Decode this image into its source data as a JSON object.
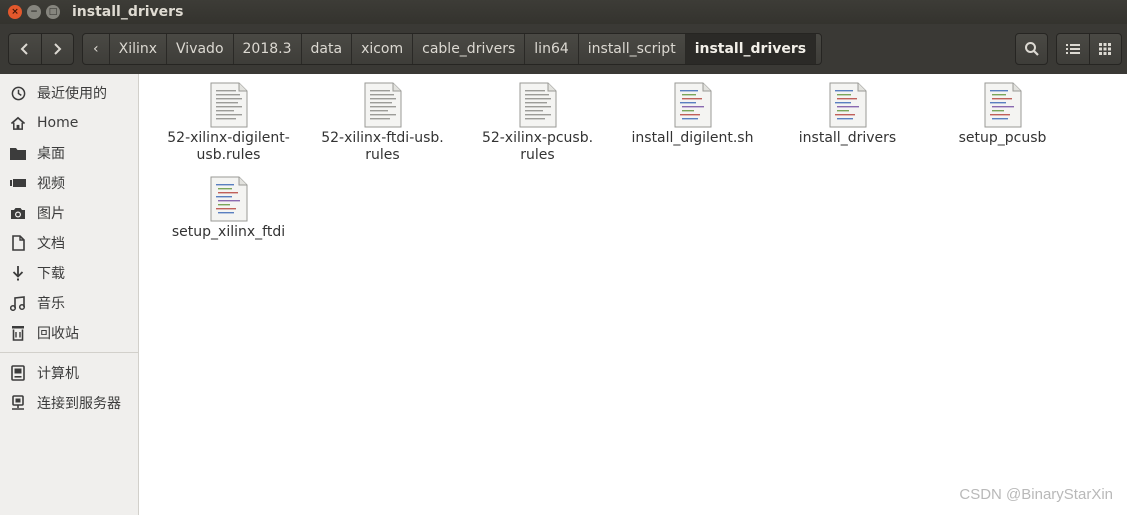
{
  "window": {
    "title": "install_drivers",
    "close_glyph": "×",
    "minimize_glyph": "−",
    "maximize_glyph": "□"
  },
  "toolbar": {
    "back_icon": "chevron-left-icon",
    "forward_icon": "chevron-right-icon",
    "path_left_arrow": "‹",
    "path_right_arrow": "›",
    "breadcrumbs": [
      "Xilinx",
      "Vivado",
      "2018.3",
      "data",
      "xicom",
      "cable_drivers",
      "lin64",
      "install_script",
      "install_drivers"
    ]
  },
  "sidebar": {
    "items": [
      {
        "label": "最近使用的",
        "icon": "clock-icon"
      },
      {
        "label": "Home",
        "icon": "home-icon"
      },
      {
        "label": "桌面",
        "icon": "folder-icon"
      },
      {
        "label": "视频",
        "icon": "video-icon"
      },
      {
        "label": "图片",
        "icon": "camera-icon"
      },
      {
        "label": "文档",
        "icon": "document-icon"
      },
      {
        "label": "下载",
        "icon": "download-icon"
      },
      {
        "label": "音乐",
        "icon": "music-icon"
      },
      {
        "label": "回收站",
        "icon": "trash-icon"
      },
      {
        "label": "计算机",
        "icon": "computer-icon"
      },
      {
        "label": "连接到服务器",
        "icon": "server-icon"
      }
    ]
  },
  "files": [
    {
      "name": "52-xilinx-digilent-usb.rules",
      "line1": "52-xilinx-digilent-",
      "line2": "usb.rules",
      "kind": "text"
    },
    {
      "name": "52-xilinx-ftdi-usb.rules",
      "line1": "52-xilinx-ftdi-usb.",
      "line2": "rules",
      "kind": "text"
    },
    {
      "name": "52-xilinx-pcusb.rules",
      "line1": "52-xilinx-pcusb.",
      "line2": "rules",
      "kind": "text"
    },
    {
      "name": "install_digilent.sh",
      "line1": "install_digilent.sh",
      "line2": "",
      "kind": "script"
    },
    {
      "name": "install_drivers",
      "line1": "install_drivers",
      "line2": "",
      "kind": "script"
    },
    {
      "name": "setup_pcusb",
      "line1": "setup_pcusb",
      "line2": "",
      "kind": "script"
    },
    {
      "name": "setup_xilinx_ftdi",
      "line1": "setup_xilinx_ftdi",
      "line2": "",
      "kind": "script"
    }
  ],
  "watermark": "CSDN @BinaryStarXin",
  "colors": {
    "titlebar": "#3d3c37",
    "toolbar": "#3a3935",
    "close_button": "#e3582c",
    "sidebar_bg": "#f0efed",
    "active_crumb": "#2b2a27"
  }
}
